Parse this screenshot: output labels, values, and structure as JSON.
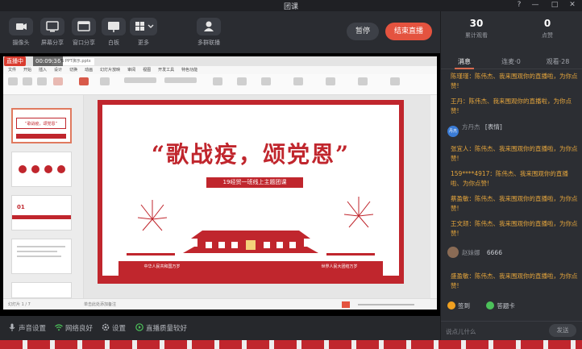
{
  "window": {
    "title": "团课",
    "controls": [
      "?",
      "—",
      "□",
      "✕"
    ]
  },
  "toolbar": {
    "items": [
      {
        "label": "摄像头",
        "icon": "camera-icon"
      },
      {
        "label": "屏幕分享",
        "icon": "screen-share-icon"
      },
      {
        "label": "窗口分享",
        "icon": "window-share-icon"
      },
      {
        "label": "白板",
        "icon": "whiteboard-icon"
      },
      {
        "label": "更多",
        "icon": "more-apps-icon"
      },
      {
        "label": "多群联播",
        "icon": "multi-group-icon"
      }
    ],
    "pause_label": "暂停",
    "end_label": "结束直播"
  },
  "live": {
    "badge": "直播中",
    "timer": "00:09:36"
  },
  "wps": {
    "tab": "WPS PPT演示.pptx",
    "menu": [
      "文件",
      "开始",
      "插入",
      "设计",
      "切换",
      "动画",
      "幻灯片放映",
      "审阅",
      "视图",
      "开发工具",
      "特色功能"
    ],
    "slide_title": "“歌战疫，颂党恩”",
    "slide_subtitle": "19经贸一班线上主题团课",
    "slide_banner_left": "中华人民共和国万岁",
    "slide_banner_right": "世界人民大团结万岁",
    "thumb_title": "“歌战疫，颂党恩”",
    "thumb_01": "01",
    "status_left": "幻灯片 1 / 7",
    "status_notes": "单击此处添加备注"
  },
  "bottom": {
    "items": [
      {
        "label": "声音设置",
        "icon": "microphone-icon"
      },
      {
        "label": "网络良好",
        "icon": "wifi-icon"
      },
      {
        "label": "设置",
        "icon": "gear-icon"
      },
      {
        "label": "直播质量较好",
        "icon": "quality-icon"
      }
    ]
  },
  "side": {
    "stats": [
      {
        "value": "30",
        "label": "累计观看"
      },
      {
        "value": "0",
        "label": "点赞"
      }
    ],
    "tabs": [
      "消息",
      "连麦·0",
      "观看·28"
    ],
    "messages": [
      {
        "type": "text",
        "text": "陈瑾瑾：陈伟杰、我来围观你的直播啦，为你点赞!"
      },
      {
        "type": "text",
        "text": "王丹：陈伟杰、我来围观你的直播啦，为你点赞!"
      },
      {
        "type": "user",
        "avatar_text": "丹杰",
        "name": "方丹杰",
        "content": "[表情]"
      },
      {
        "type": "text",
        "text": "张宜人：陈伟杰、我来围观你的直播啦，为你点赞!"
      },
      {
        "type": "text",
        "text": "159****4917：陈伟杰、我来围观你的直播啦、为你点赞!"
      },
      {
        "type": "text",
        "text": "蔡盈敏：陈伟杰、我来围观你的直播啦，为你点赞!"
      },
      {
        "type": "text",
        "text": "王文颉：陈伟杰、我来围观你的直播啦，为你点赞!"
      },
      {
        "type": "user",
        "avatar_text": "",
        "name": "赵妹娜",
        "content": "6666"
      },
      {
        "type": "text",
        "text": "盛盈敏：陈伟杰、我来围观你的直播啦，为你点赞!"
      }
    ],
    "gifts": [
      "签到",
      "答题卡"
    ],
    "input_placeholder": "说点儿什么",
    "send_label": "发送"
  },
  "colors": {
    "accent": "#e4533f",
    "chat_text": "#e5a53c",
    "slide_red": "#c0262d"
  }
}
